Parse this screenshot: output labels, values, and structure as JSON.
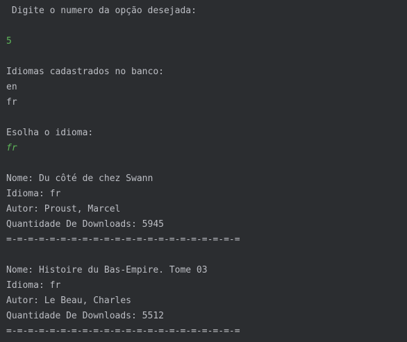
{
  "console": {
    "prompt_menu": " Digite o numero da opção desejada:",
    "menu_input": "5",
    "languages_heading": "Idiomas cadastrados no banco:",
    "languages": [
      "en",
      "fr"
    ],
    "choose_prompt": "Esolha o idioma:",
    "language_input": "fr",
    "books": [
      {
        "name": "Nome: Du côté de chez Swann",
        "language": "Idioma: fr",
        "author": "Autor: Proust, Marcel",
        "downloads": "Quantidade De Downloads: 5945",
        "separator": "=-=-=-=-=-=-=-=-=-=-=-=-=-=-=-=-=-=-=-=-=-="
      },
      {
        "name": "Nome: Histoire du Bas-Empire. Tome 03",
        "language": "Idioma: fr",
        "author": "Autor: Le Beau, Charles",
        "downloads": "Quantidade De Downloads: 5512",
        "separator": "=-=-=-=-=-=-=-=-=-=-=-=-=-=-=-=-=-=-=-=-=-="
      }
    ]
  },
  "colors": {
    "background": "#2b2d30",
    "text": "#bcbec4",
    "user_input": "#5fb85a"
  }
}
